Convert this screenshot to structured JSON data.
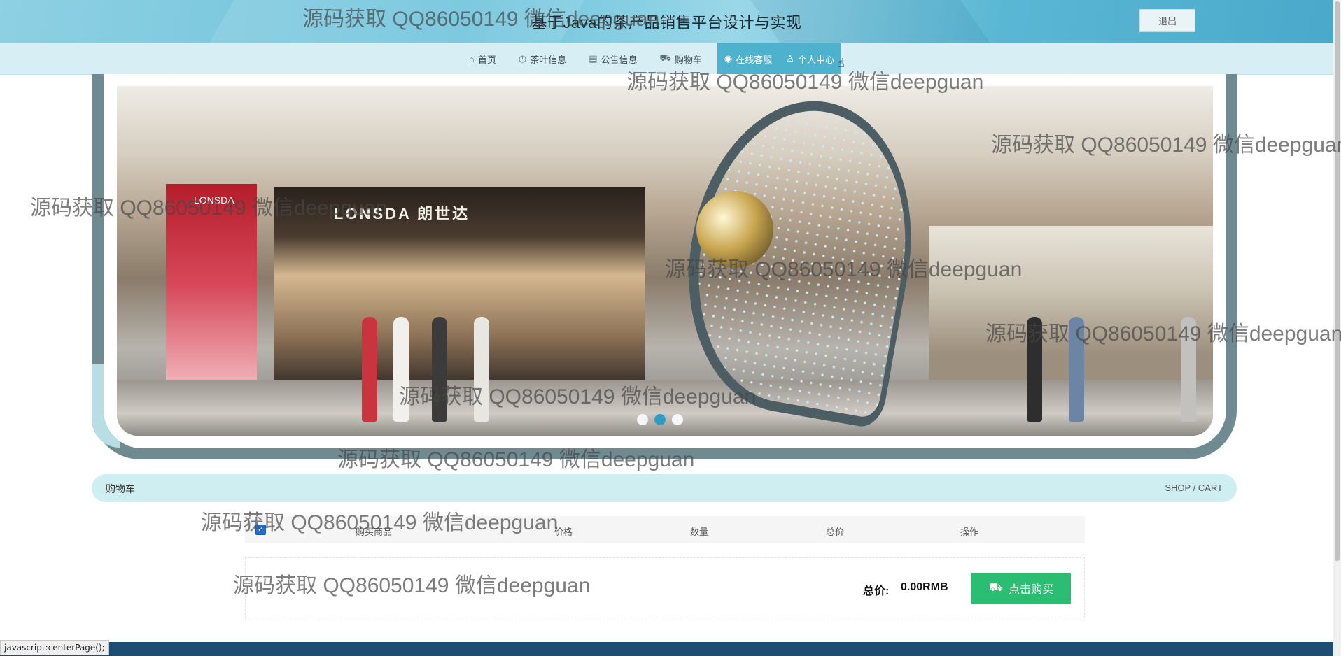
{
  "header": {
    "title": "基于Java的茶产品销售平台设计与实现",
    "logout_label": "退出"
  },
  "nav": {
    "items": [
      {
        "label": "首页",
        "icon": "home-icon"
      },
      {
        "label": "茶叶信息",
        "icon": "clock-icon"
      },
      {
        "label": "公告信息",
        "icon": "notice-icon"
      },
      {
        "label": "购物车",
        "icon": "cart-icon"
      },
      {
        "label": "在线客服",
        "icon": "chat-icon"
      },
      {
        "label": "个人中心",
        "icon": "user-icon"
      }
    ]
  },
  "banner": {
    "slides": 3,
    "active_slide": 2,
    "sign_left": "LONSDA",
    "sign_center": "LONSDA 朗世达"
  },
  "section": {
    "title": "购物车",
    "subtitle": "SHOP / CART"
  },
  "cart": {
    "columns": [
      "购买商品",
      "价格",
      "数量",
      "总价",
      "操作"
    ],
    "select_all_checked": true,
    "total_label": "总价:",
    "total_value": "0.00RMB",
    "buy_label": "点击购买"
  },
  "status_bar": {
    "text": "javascript:centerPage();"
  },
  "watermark": {
    "text": "源码获取 QQ86050149 微信deepguan"
  },
  "colors": {
    "header": "#6cc2db",
    "nav_active": "#4eb2cf",
    "buy_button": "#2bbd72",
    "section_bar": "#cfeef2"
  }
}
